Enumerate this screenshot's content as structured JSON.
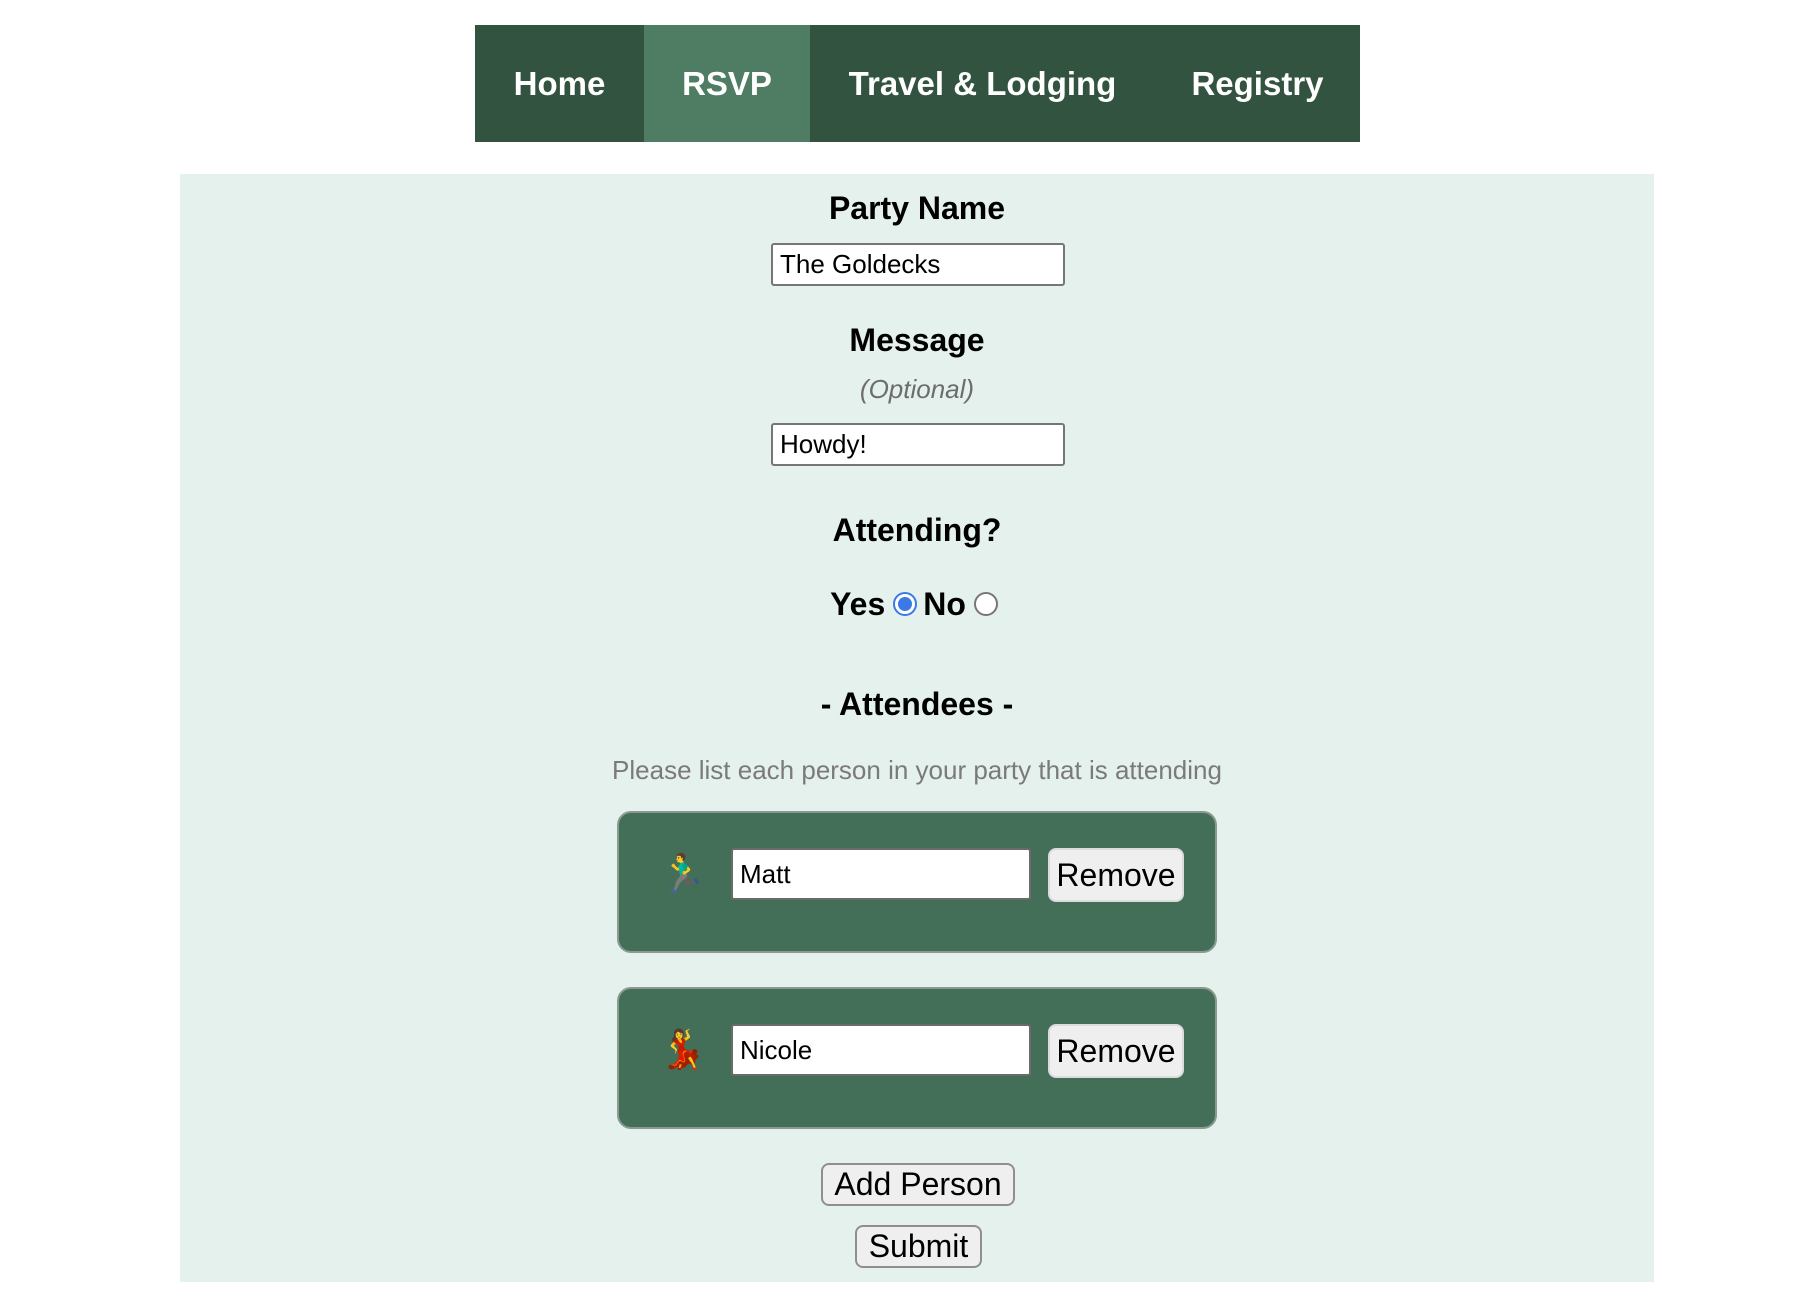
{
  "nav": {
    "tabs": [
      {
        "label": "Home",
        "active": false
      },
      {
        "label": "RSVP",
        "active": true
      },
      {
        "label": "Travel & Lodging",
        "active": false
      },
      {
        "label": "Registry",
        "active": false
      }
    ]
  },
  "form": {
    "party_name_label": "Party Name",
    "party_name_value": "The Goldecks",
    "message_label": "Message",
    "message_optional": "(Optional)",
    "message_value": "Howdy!",
    "attending_label": "Attending?",
    "attending_options": [
      "Yes",
      "No"
    ],
    "attending_selected": "Yes",
    "attendees_heading": "- Attendees -",
    "attendees_hint": "Please list each person in your party that is attending",
    "attendees": [
      {
        "name": "Matt",
        "icon": "person-running-icon",
        "glyph": "🏃‍♂️",
        "remove_label": "Remove"
      },
      {
        "name": "Nicole",
        "icon": "woman-dancing-icon",
        "glyph": "💃",
        "remove_label": "Remove"
      }
    ],
    "add_person_label": "Add Person",
    "submit_label": "Submit"
  },
  "colors": {
    "nav_bg": "#31533f",
    "nav_active": "#4e7d63",
    "panel_bg": "#e5f1ec",
    "card_bg": "#436e58",
    "radio_accent": "#3a79e6"
  }
}
